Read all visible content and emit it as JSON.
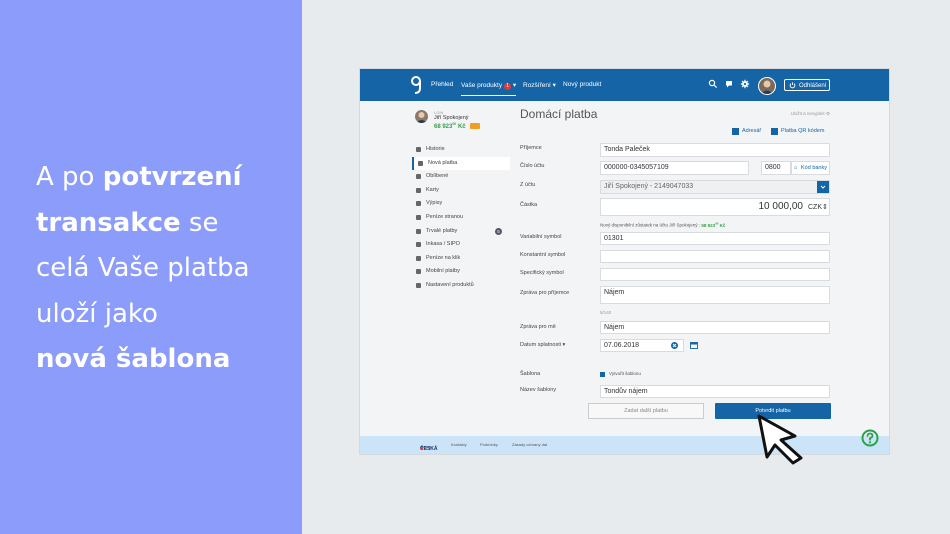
{
  "slide": {
    "line1_normal": "A po ",
    "line1_bold": "potvrzení",
    "line2_bold": "transakce",
    "line2_normal": " se",
    "line3": "celá Vaše platba",
    "line4": "uloží jako",
    "line5_bold": "nová šablona"
  },
  "topnav": {
    "overview": "Přehled",
    "products": "Vaše produkty",
    "products_badge": "1",
    "extensions": "Rozšíření",
    "new_product": "Nový produkt",
    "logout": "Odhlášení"
  },
  "user": {
    "prefix": "LGIN",
    "name": "Jiří Spokojený",
    "balance": "68 923",
    "balance_cents": "00",
    "currency": "Kč"
  },
  "sidebar": {
    "items": [
      {
        "label": "Historie",
        "icon": "list-icon"
      },
      {
        "label": "Nová platba",
        "icon": "payment-icon"
      },
      {
        "label": "Oblíbené",
        "icon": "star-icon"
      },
      {
        "label": "Karty",
        "icon": "card-icon"
      },
      {
        "label": "Výpisy",
        "icon": "document-icon"
      },
      {
        "label": "Peníze stranou",
        "icon": "piggy-icon"
      },
      {
        "label": "Trvalé platby",
        "icon": "calendar-icon",
        "count": "5"
      },
      {
        "label": "Inkasa / SIPO",
        "icon": "invoice-icon"
      },
      {
        "label": "Peníze na klik",
        "icon": "click-icon"
      },
      {
        "label": "Mobilní platby",
        "icon": "mobile-icon"
      },
      {
        "label": "Nastavení produktů",
        "icon": "settings-icon"
      }
    ]
  },
  "form": {
    "title": "Domácí platba",
    "save_link": "Uložit a nevyplnit",
    "address_link": "Adresář",
    "qr_link": "Platba QR kódem",
    "recipient_label": "Příjemce",
    "recipient_value": "Tonda Paleček",
    "account_label": "Číslo účtu",
    "account_value": "000000-0345057109",
    "bank_code_value": "0800",
    "bank_code_link": "Kód banky",
    "from_label": "Z účtu",
    "from_value": "Jiří Spokojený - 2149047033",
    "amount_label": "Částka",
    "amount_value": "10 000,00",
    "currency_value": "CZK",
    "balance_hint_text": "Nový disponibilní zůstatek na účtu Jiří Spokojený : ",
    "balance_hint_value": "58 923",
    "balance_hint_cents": "00",
    "balance_hint_currency": " Kč",
    "vs_label": "Variabilní symbol",
    "vs_value": "01301",
    "ks_label": "Konstantní symbol",
    "ks_value": "",
    "ss_label": "Specifický symbol",
    "ss_value": "",
    "msg_recipient_label": "Zpráva pro příjemce",
    "msg_recipient_value": "Nájem",
    "char_count": "5/140",
    "msg_me_label": "Zpráva pro mě",
    "msg_me_value": "Nájem",
    "due_label": "Datum splatnosti",
    "due_value": "07.06.2018",
    "template_label": "Šablona",
    "template_checkbox_label": "Vytvořit šablonu",
    "template_name_label": "Název šablony",
    "template_name_value": "Tondův nájem",
    "secondary_button": "Zadat další platbu",
    "primary_button": "Potvrdit platbu"
  },
  "footer": {
    "brand": "ČESKÁ",
    "brand_sub": "spořitelna",
    "contacts": "Kontakty",
    "terms": "Podmínky",
    "privacy": "Zásady ochrany dat"
  },
  "colors": {
    "accent": "#1565a6",
    "slide_bg": "#8c9cfb",
    "positive": "#35a048",
    "help": "#2aa14a"
  }
}
